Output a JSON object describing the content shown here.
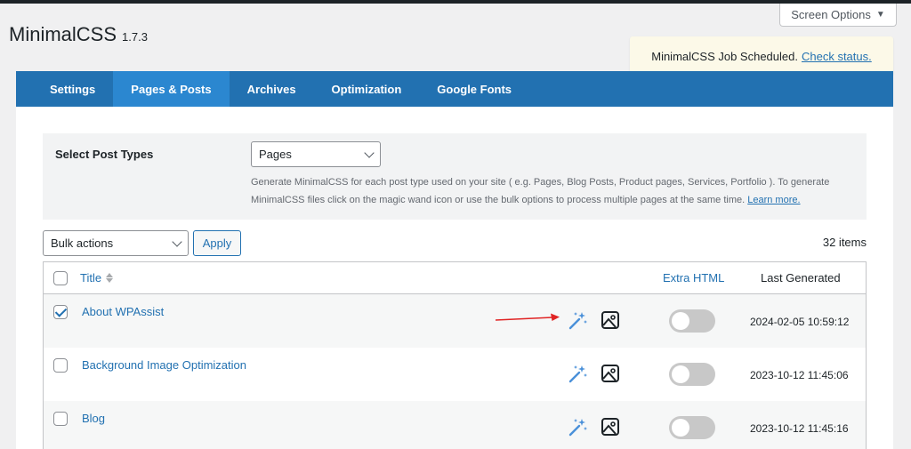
{
  "header": {
    "screen_options_label": "Screen Options",
    "plugin_name": "MinimalCSS",
    "plugin_version": "1.7.3"
  },
  "notice": {
    "text": "MinimalCSS Job Scheduled.",
    "link": "Check status."
  },
  "tabs": [
    {
      "label": "Settings",
      "active": false
    },
    {
      "label": "Pages & Posts",
      "active": true
    },
    {
      "label": "Archives",
      "active": false
    },
    {
      "label": "Optimization",
      "active": false
    },
    {
      "label": "Google Fonts",
      "active": false
    }
  ],
  "post_types": {
    "label": "Select Post Types",
    "selected": "Pages",
    "description": "Generate MinimalCSS for each post type used on your site ( e.g. Pages, Blog Posts, Product pages, Services, Portfolio ). To generate MinimalCSS files click on the magic wand icon or use the bulk options to process multiple pages at the same time.",
    "learn_more": "Learn more."
  },
  "bulk": {
    "selected": "Bulk actions",
    "apply_label": "Apply",
    "items_count": "32 items"
  },
  "table": {
    "headers": {
      "title": "Title",
      "extra_html": "Extra HTML",
      "last_generated": "Last Generated"
    },
    "rows": [
      {
        "title": "About WPAssist",
        "checked": true,
        "last_generated": "2024-02-05 10:59:12"
      },
      {
        "title": "Background Image Optimization",
        "checked": false,
        "last_generated": "2023-10-12 11:45:06"
      },
      {
        "title": "Blog",
        "checked": false,
        "last_generated": "2023-10-12 11:45:16"
      }
    ]
  },
  "icons": {
    "wand": "magic-wand-icon",
    "image": "image-icon"
  },
  "colors": {
    "accent": "#2271b1",
    "tab_active": "#2b87d0",
    "notice_bg": "#fcf9e8",
    "annotation_arrow": "#e02424"
  }
}
